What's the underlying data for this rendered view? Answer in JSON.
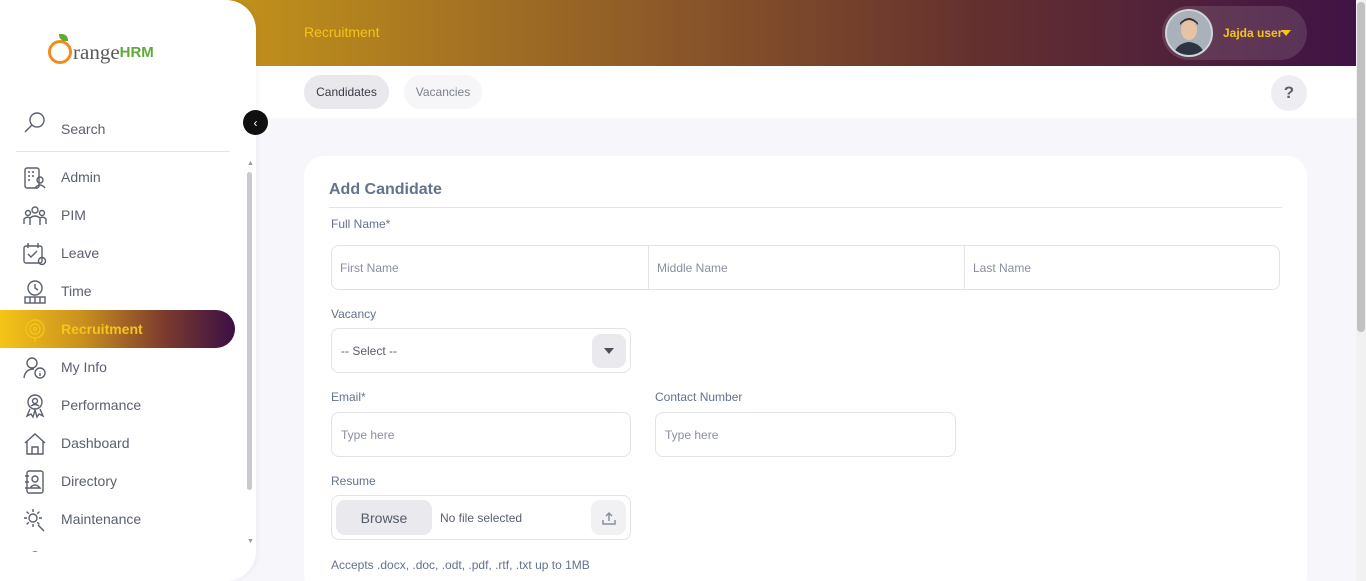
{
  "header": {
    "module_title": "Recruitment",
    "user_name": "Jajda user"
  },
  "tabs": [
    {
      "label": "Candidates"
    },
    {
      "label": "Vacancies"
    }
  ],
  "help": {
    "label": "?"
  },
  "sidebar": {
    "logo": {
      "text": "range",
      "suffix": "HRM"
    },
    "search_label": "Search",
    "items": [
      {
        "label": "Admin",
        "icon": "admin-icon"
      },
      {
        "label": "PIM",
        "icon": "pim-icon"
      },
      {
        "label": "Leave",
        "icon": "leave-icon"
      },
      {
        "label": "Time",
        "icon": "time-icon"
      },
      {
        "label": "Recruitment",
        "icon": "recruitment-icon",
        "active": true
      },
      {
        "label": "My Info",
        "icon": "my-info-icon"
      },
      {
        "label": "Performance",
        "icon": "performance-icon"
      },
      {
        "label": "Dashboard",
        "icon": "dashboard-icon"
      },
      {
        "label": "Directory",
        "icon": "directory-icon"
      },
      {
        "label": "Maintenance",
        "icon": "maintenance-icon"
      }
    ]
  },
  "form": {
    "title": "Add Candidate",
    "full_name_label": "Full Name*",
    "first_name_placeholder": "First Name",
    "middle_name_placeholder": "Middle Name",
    "last_name_placeholder": "Last Name",
    "vacancy_label": "Vacancy",
    "vacancy_value": "-- Select --",
    "email_label": "Email*",
    "email_placeholder": "Type here",
    "contact_label": "Contact Number",
    "contact_placeholder": "Type here",
    "resume_label": "Resume",
    "browse_label": "Browse",
    "file_status": "No file selected",
    "file_hint": "Accepts .docx, .doc, .odt, .pdf, .rtf, .txt up to 1MB"
  },
  "colors": {
    "brand_orange": "#f28c1c",
    "brand_green": "#5fa93b",
    "accent_yellow": "#f5c518",
    "header_dark": "#3f1345"
  }
}
